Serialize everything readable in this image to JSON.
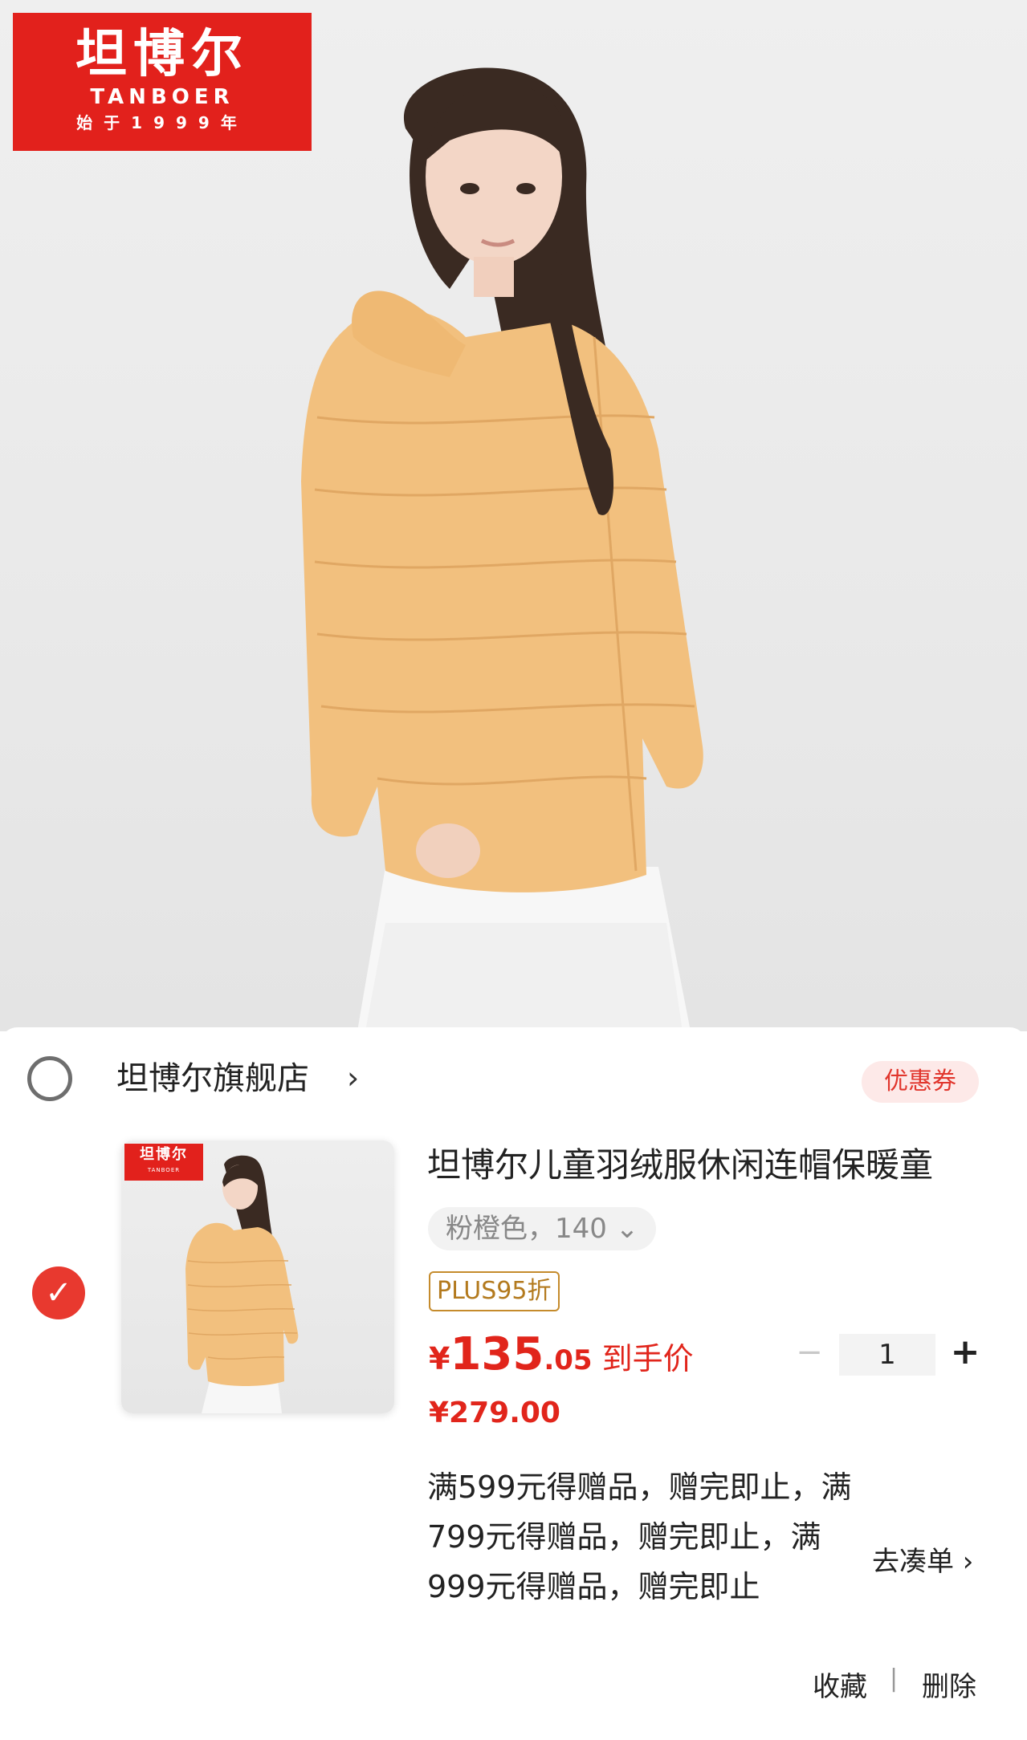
{
  "brand": {
    "name_cn": "坦博尔",
    "name_en": "TANBOER",
    "since": "始于1999年"
  },
  "store": {
    "name": "坦博尔旗舰店",
    "arrow": "›",
    "coupon_label": "优惠券"
  },
  "item": {
    "title": "坦博尔儿童羽绒服休闲连帽保暖童",
    "spec": "粉橙色，140 ⌄",
    "plus_badge": "PLUS95折",
    "price_currency": "¥",
    "price_integer": "135",
    "price_decimal": ".05",
    "price_tag": "到手价",
    "original_price": "¥279.00",
    "quantity": "1",
    "qty_minus": "−",
    "qty_plus": "+",
    "check_icon": "✓",
    "promo_text": "满599元得赠品，赠完即止，满799元得赠品，赠完即止，满999元得赠品，赠完即止",
    "promo_link": "去凑单 ›"
  },
  "actions": {
    "favorite": "收藏",
    "separator": "|",
    "delete": "删除"
  },
  "colors": {
    "brand_red": "#e2211c",
    "price_red": "#e1251b",
    "jacket": "#f2c07e"
  },
  "icons": {
    "store_radio": "circle-outline-icon",
    "item_check": "check-circle-icon"
  }
}
